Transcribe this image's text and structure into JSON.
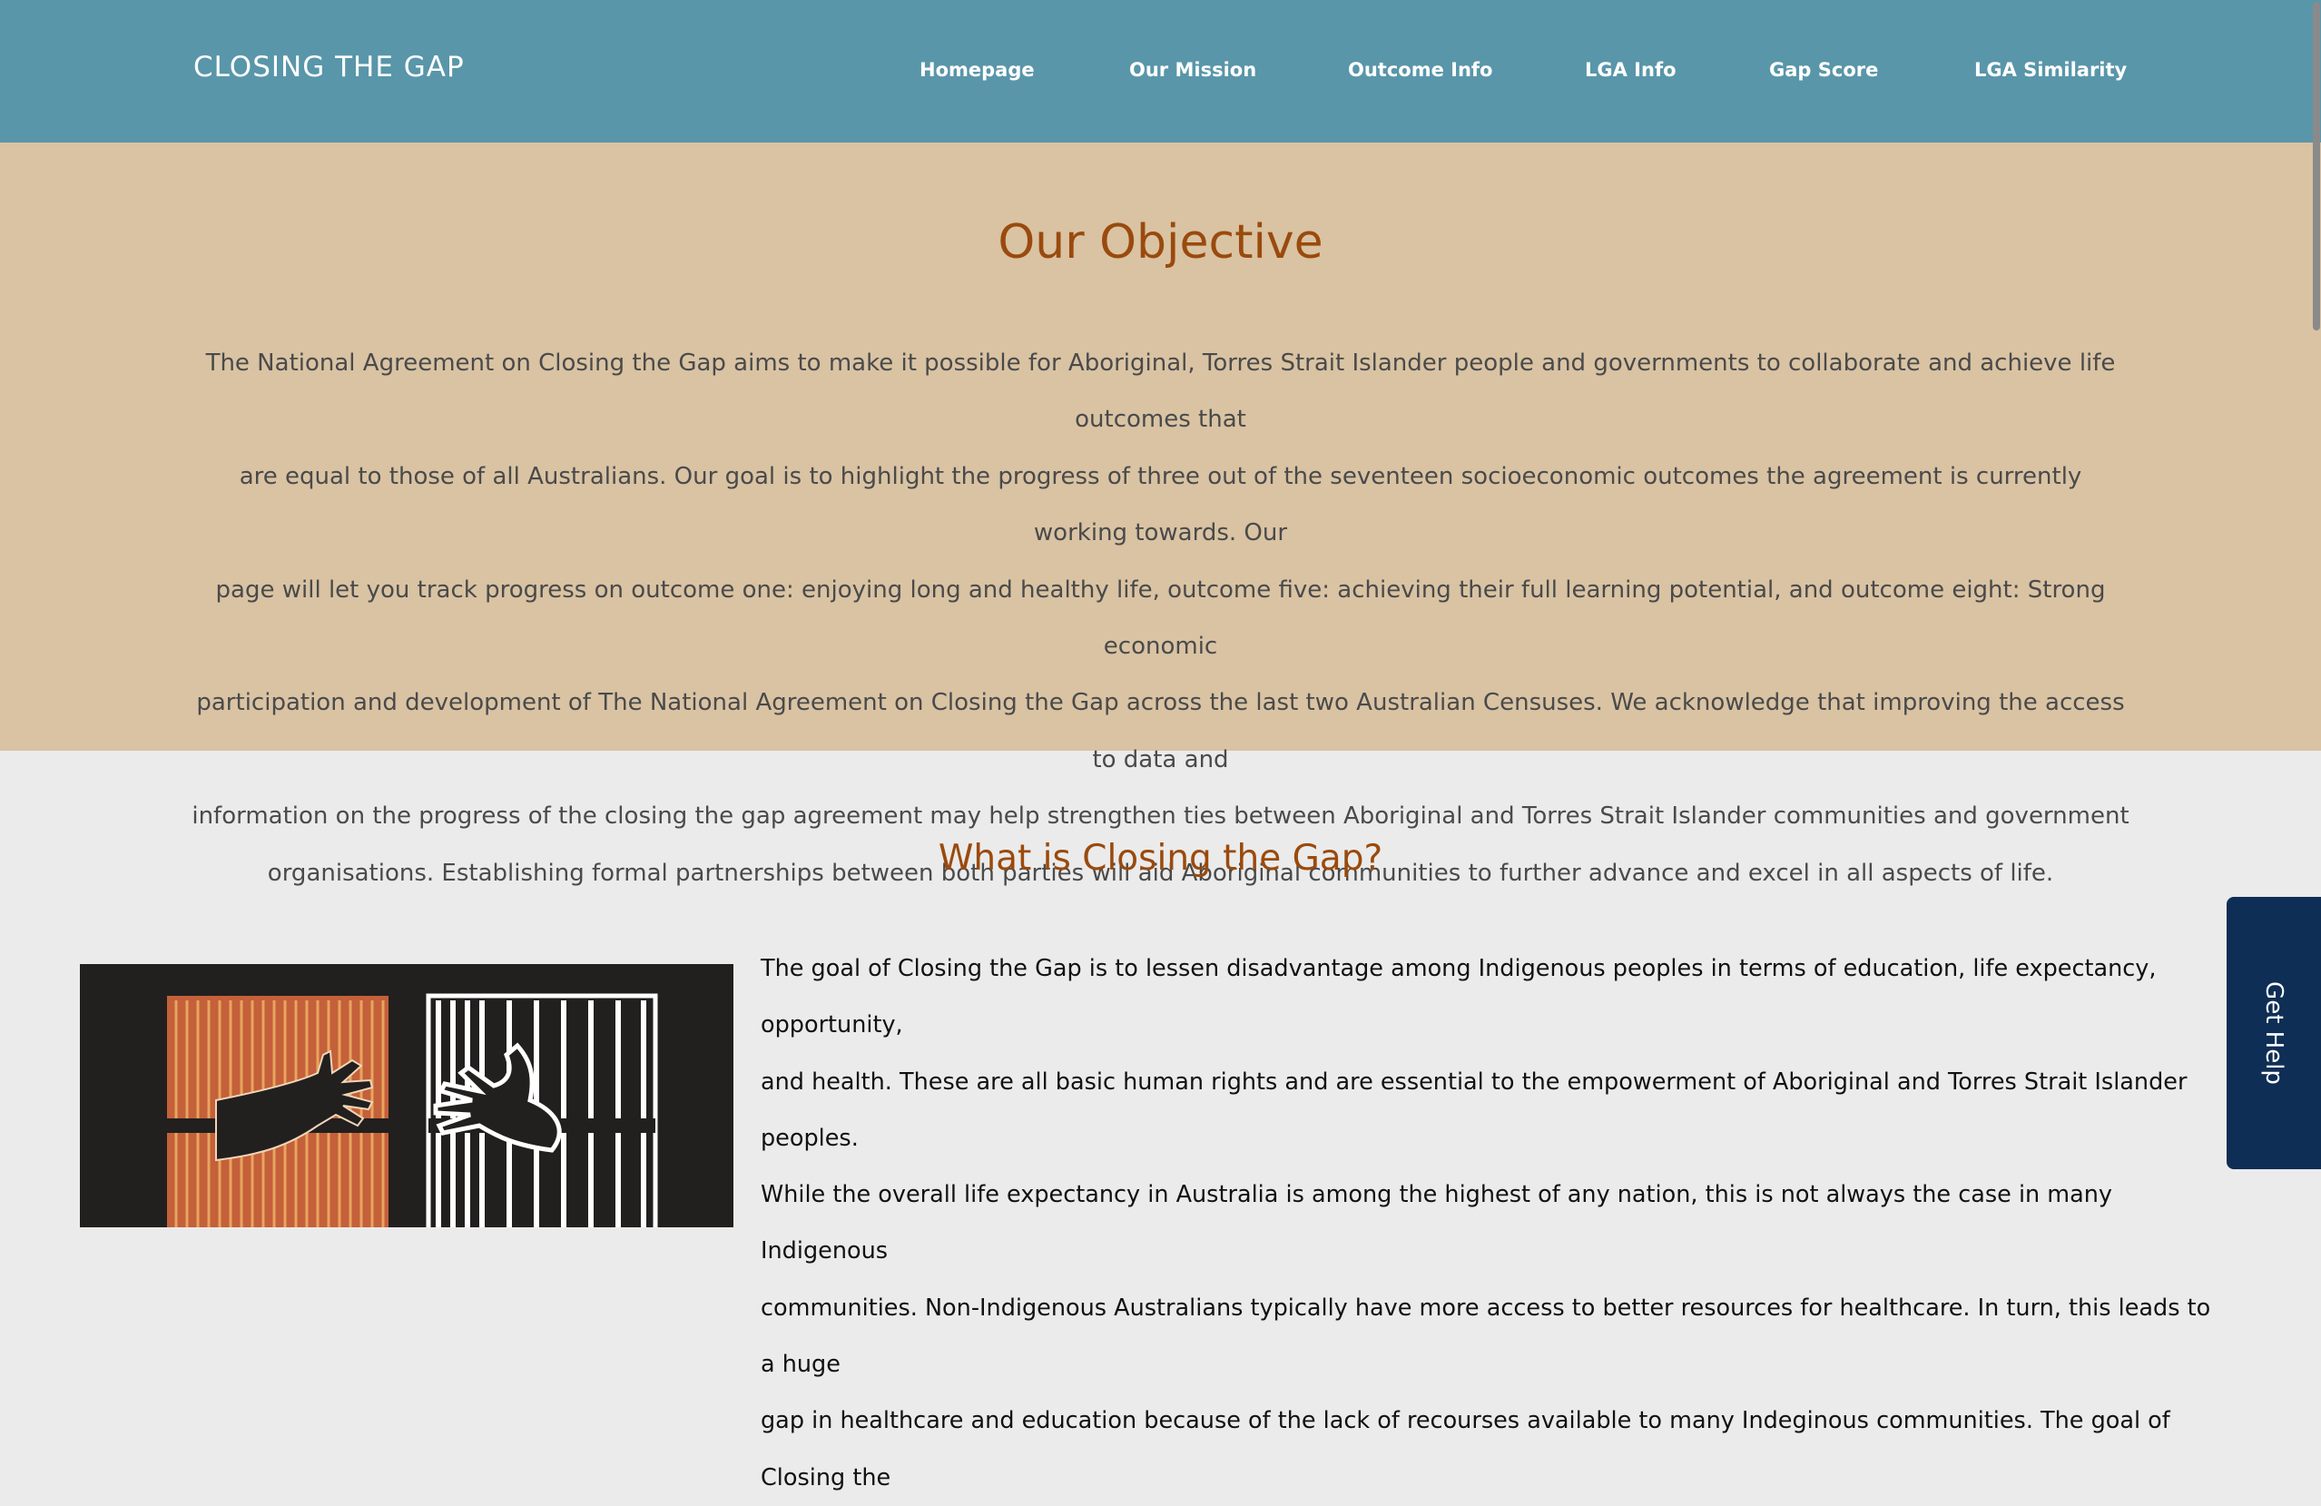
{
  "header": {
    "brand": "CLOSING THE GAP",
    "nav": [
      {
        "label": "Homepage"
      },
      {
        "label": "Our Mission"
      },
      {
        "label": "Outcome Info"
      },
      {
        "label": "LGA Info"
      },
      {
        "label": "Gap Score"
      },
      {
        "label": "LGA Similarity"
      }
    ]
  },
  "objective": {
    "title": "Our Objective",
    "lines": [
      "The National Agreement on Closing the Gap aims to make it possible for Aboriginal, Torres Strait Islander people and governments to collaborate and achieve life outcomes that",
      "are equal to those of all Australians. Our goal is to highlight the progress of three out of the seventeen socioeconomic outcomes the agreement is currently working towards. Our",
      "page will let you track progress on outcome one: enjoying long and healthy life, outcome five: achieving their full learning potential, and outcome eight: Strong economic",
      "participation and development of The National Agreement on Closing the Gap across the last two Australian Censuses. We acknowledge that improving the access to data and",
      "information on the progress of the closing the gap agreement may help strengthen ties between Aboriginal and Torres Strait Islander communities and government",
      "organisations. Establishing formal partnerships between both parties will aid Aboriginal communities to further advance and excel in all aspects of life."
    ]
  },
  "what": {
    "title": "What is Closing the Gap?",
    "lines": [
      "The goal of Closing the Gap is to lessen disadvantage among Indigenous peoples in terms of education, life expectancy, opportunity,",
      "and health. These are all basic human rights and are essential to the empowerment of Aboriginal and Torres Strait Islander peoples.",
      "While the overall life expectancy in Australia is among the highest of any nation, this is not always the case in many Indigenous",
      "communities. Non-Indigenous Australians typically have more access to better resources for healthcare. In turn, this leads to a huge",
      "gap in healthcare and education because of the lack of recourses available to many Indeginous communities. The goal of Closing the"
    ]
  },
  "help_tab": {
    "label": "Get Help"
  },
  "colors": {
    "navbar_bg": "#5996a9",
    "objective_bg": "#d9c3a3",
    "heading": "#9a4a0d",
    "body_bg": "#ebebeb",
    "help_bg": "#0f2e55",
    "art_bg": "#221f1f",
    "art_orange": "#c4603a"
  }
}
